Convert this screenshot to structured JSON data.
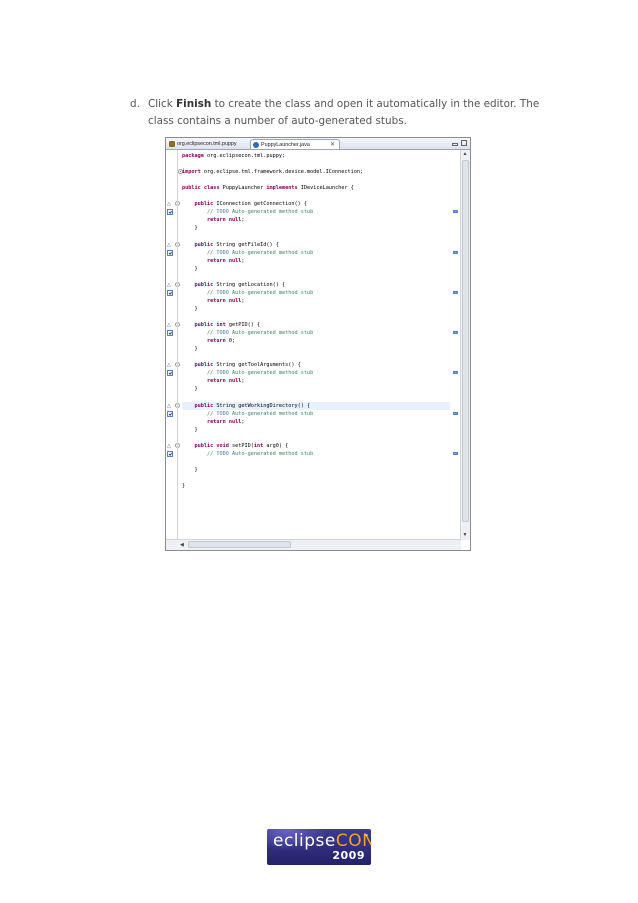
{
  "instruction": {
    "marker": "d.",
    "before": "Click ",
    "bold": "Finish",
    "after": " to create the class and open it automatically in the editor. The class contains a number of auto-generated stubs."
  },
  "editor": {
    "tabs": [
      {
        "label": "org.eclipsecon.tml.puppy",
        "active": false
      },
      {
        "label": "PuppyLauncher.java",
        "active": true
      }
    ],
    "close_glyph": "✕",
    "code_lines": [
      {
        "t": "package org.eclipsecon.tml.puppy;"
      },
      {
        "t": ""
      },
      {
        "t": "import org.eclipse.tml.framework.device.model.IConnection;"
      },
      {
        "t": ""
      },
      {
        "t": "public class PuppyLauncher implements IDeviceLauncher {"
      },
      {
        "t": ""
      },
      {
        "t": "    public IConnection getConnection() {"
      },
      {
        "t": "        // TODO Auto-generated method stub"
      },
      {
        "t": "        return null;"
      },
      {
        "t": "    }"
      },
      {
        "t": ""
      },
      {
        "t": "    public String getFileId() {"
      },
      {
        "t": "        // TODO Auto-generated method stub"
      },
      {
        "t": "        return null;"
      },
      {
        "t": "    }"
      },
      {
        "t": ""
      },
      {
        "t": "    public String getLocation() {"
      },
      {
        "t": "        // TODO Auto-generated method stub"
      },
      {
        "t": "        return null;"
      },
      {
        "t": "    }"
      },
      {
        "t": ""
      },
      {
        "t": "    public int getPID() {"
      },
      {
        "t": "        // TODO Auto-generated method stub"
      },
      {
        "t": "        return 0;"
      },
      {
        "t": "    }"
      },
      {
        "t": ""
      },
      {
        "t": "    public String getToolArguments() {"
      },
      {
        "t": "        // TODO Auto-generated method stub"
      },
      {
        "t": "        return null;"
      },
      {
        "t": "    }"
      },
      {
        "t": ""
      },
      {
        "t": "    public String getWorkingDirectory() {"
      },
      {
        "t": "        // TODO Auto-generated method stub"
      },
      {
        "t": "        return null;"
      },
      {
        "t": "    }"
      },
      {
        "t": ""
      },
      {
        "t": "    public void setPID(int arg0) {"
      },
      {
        "t": "        // TODO Auto-generated method stub"
      },
      {
        "t": ""
      },
      {
        "t": "    }"
      },
      {
        "t": ""
      },
      {
        "t": "}"
      }
    ]
  },
  "logo": {
    "word_main": "eclipse",
    "word_accent": "CON",
    "tm": "™",
    "year": "2009"
  }
}
